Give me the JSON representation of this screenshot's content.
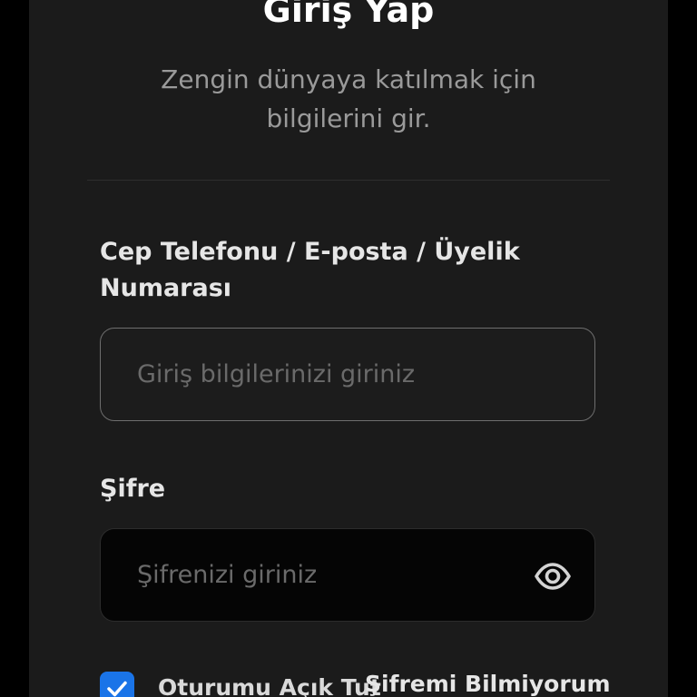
{
  "header": {
    "title": "Giriş Yap",
    "subtitle": "Zengin dünyaya katılmak için bilgilerini gir."
  },
  "login": {
    "label": "Cep Telefonu / E-posta / Üyelik Numarası",
    "placeholder": "Giriş bilgilerinizi giriniz",
    "value": ""
  },
  "password": {
    "label": "Şifre",
    "placeholder": "Şifrenizi giriniz",
    "value": "",
    "toggle_icon": "eye-icon"
  },
  "options": {
    "remember_label": "Oturumu Açık Tut",
    "remember_checked": true,
    "forgot_label": "Şifremi Bilmiyorum"
  },
  "colors": {
    "background": "#000000",
    "panel": "#1b1b1b",
    "accent": "#1a74e8"
  }
}
